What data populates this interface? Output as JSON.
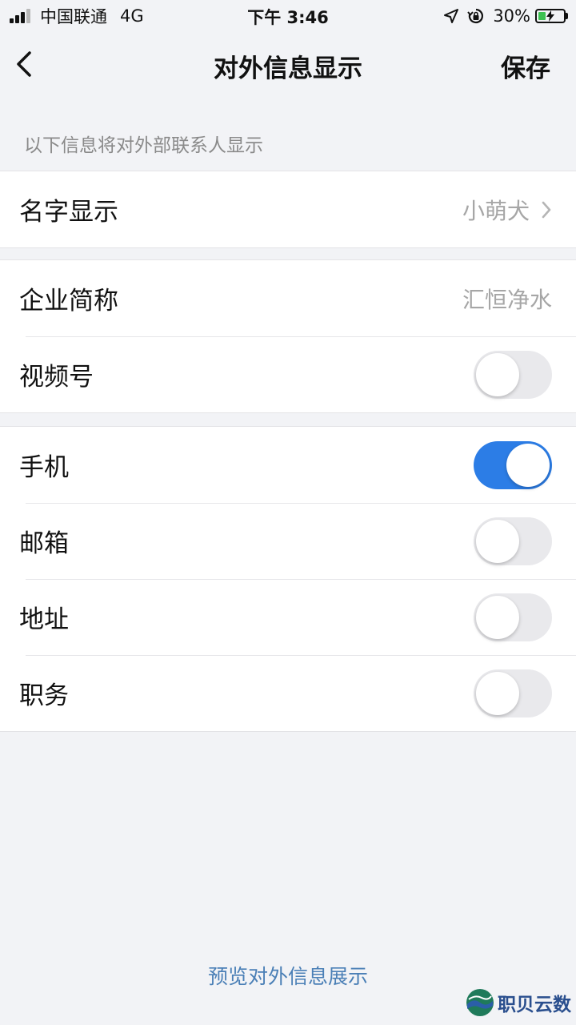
{
  "status_bar": {
    "carrier": "中国联通",
    "network": "4G",
    "time": "下午 3:46",
    "battery": "30%",
    "battery_level": 0.3
  },
  "nav": {
    "back_icon": "chevron-left-icon",
    "title": "对外信息显示",
    "save_label": "保存"
  },
  "hint": "以下信息将对外部联系人显示",
  "group1": {
    "name_row": {
      "label": "名字显示",
      "value": "小萌犬"
    }
  },
  "group2": {
    "company_row": {
      "label": "企业简称",
      "value": "汇恒净水"
    },
    "video_row": {
      "label": "视频号",
      "toggle": false
    }
  },
  "group3": {
    "phone_row": {
      "label": "手机",
      "toggle": true
    },
    "email_row": {
      "label": "邮箱",
      "toggle": false
    },
    "address_row": {
      "label": "地址",
      "toggle": false
    },
    "position_row": {
      "label": "职务",
      "toggle": false
    }
  },
  "footer": {
    "preview_label": "预览对外信息展示"
  },
  "watermark": {
    "text": "职贝云数"
  },
  "colors": {
    "accent": "#2c7de6",
    "link": "#4a7fb6",
    "background": "#f2f3f6"
  }
}
